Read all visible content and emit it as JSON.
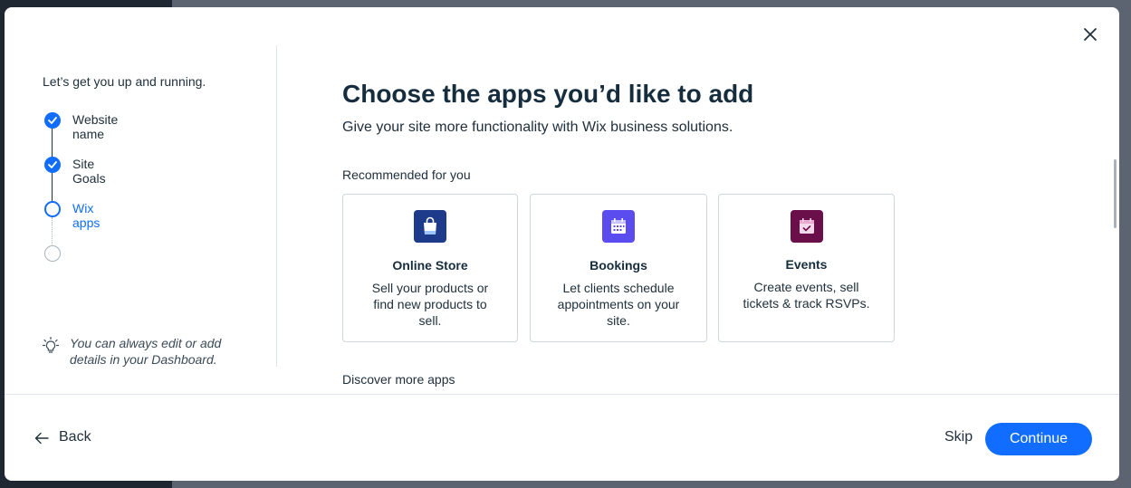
{
  "sidebar": {
    "intro": "Let’s get you up and running.",
    "steps": [
      {
        "label": "Website name",
        "state": "done"
      },
      {
        "label": "Site Goals",
        "state": "done"
      },
      {
        "label": "Wix apps",
        "state": "active"
      },
      {
        "label": "",
        "state": "todo"
      }
    ],
    "tip": "You can always edit or add details in your Dashboard."
  },
  "main": {
    "title": "Choose the apps you’d like to add",
    "subtitle": "Give your site more functionality with Wix business solutions.",
    "recommended_label": "Recommended for you",
    "discover_label": "Discover more apps",
    "apps": [
      {
        "name": "Online Store",
        "description": "Sell your products or find new products to sell.",
        "icon": "shopping-bag-icon",
        "color": "#1e3a8a"
      },
      {
        "name": "Bookings",
        "description": "Let clients schedule appointments on your site.",
        "icon": "calendar-icon",
        "color": "#5b4cf0"
      },
      {
        "name": "Events",
        "description": "Create events, sell tickets & track RSVPs.",
        "icon": "event-calendar-icon",
        "color": "#6b0f4a"
      }
    ]
  },
  "footer": {
    "back_label": "Back",
    "skip_label": "Skip",
    "continue_label": "Continue"
  },
  "colors": {
    "accent": "#116dff"
  }
}
